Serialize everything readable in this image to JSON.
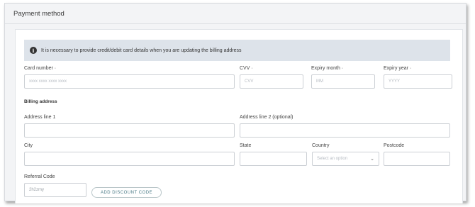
{
  "section": {
    "title": "Payment method"
  },
  "info": {
    "message": "It is necessary to provide credit/debit card details when you are updating the billing address"
  },
  "card": {
    "number_label": "Card number ·",
    "number_placeholder": "xxxx xxxx xxxx xxxx",
    "cvv_label": "CVV ·",
    "cvv_placeholder": "CVV",
    "expiry_month_label": "Expiry month ·",
    "expiry_month_placeholder": "MM",
    "expiry_year_label": "Expiry year ·",
    "expiry_year_placeholder": "YYYY"
  },
  "billing": {
    "heading": "Billing address",
    "address1_label": "Address line 1",
    "address2_label": "Address line 2 (optional)",
    "city_label": "City",
    "state_label": "State",
    "country_label": "Country",
    "country_selected": "Select an option",
    "postcode_label": "Postcode"
  },
  "referral": {
    "label": "Referral Code",
    "value": "2h2zmy",
    "discount_button": "ADD DISCOUNT CODE"
  },
  "icons": {
    "info": "info-circle-icon",
    "chevron": "chevron-down-icon"
  }
}
